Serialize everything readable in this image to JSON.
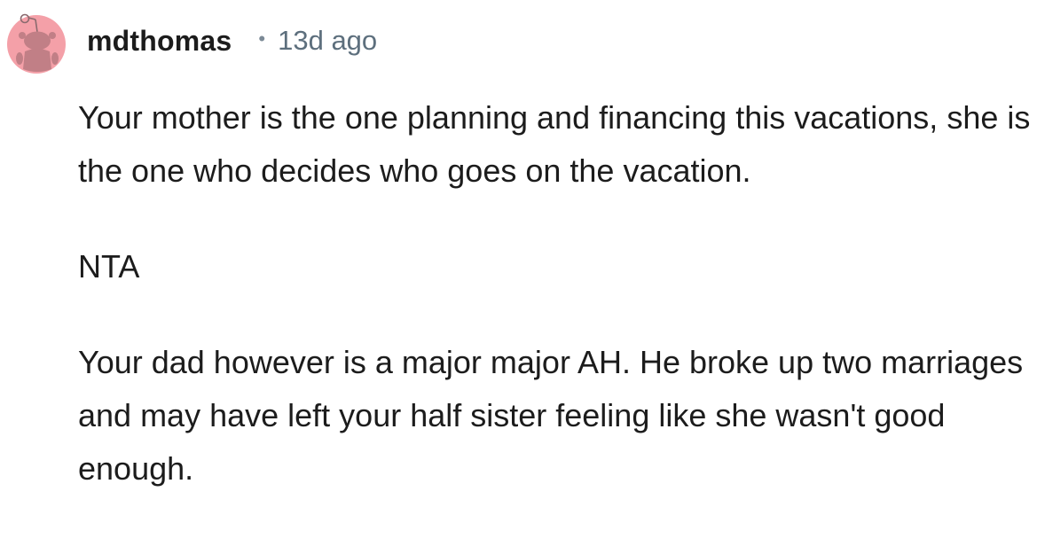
{
  "comment": {
    "author": "mdthomas",
    "separator": "•",
    "timestamp": "13d ago",
    "avatar_icon": "reddit-snoo-avatar-icon",
    "avatar_color": "#f4a0a8",
    "paragraphs": [
      "Your mother is the one planning and financing this vacations, she is the one who decides who goes on the vacation.",
      "NTA",
      "Your dad however is a major major AH. He broke up two marriages and may have left your half sister feeling like she wasn't good enough."
    ]
  }
}
